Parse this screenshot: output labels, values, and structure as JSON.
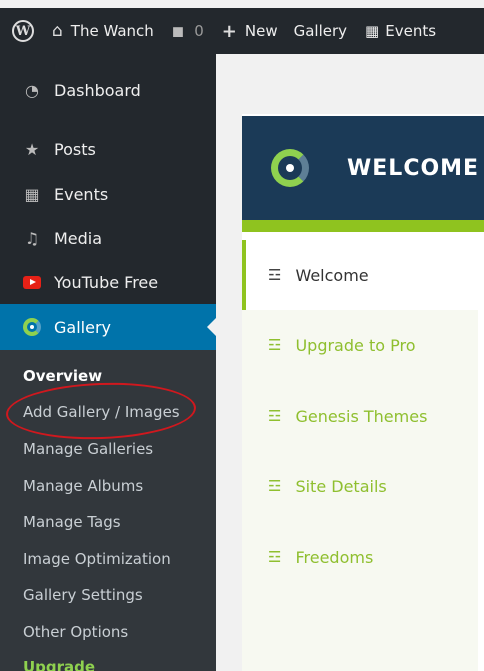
{
  "admin_bar": {
    "site_name": "The Wanch",
    "comments_count": "0",
    "new_label": "New",
    "gallery_label": "Gallery",
    "events_label": "Events"
  },
  "sidebar": {
    "items": [
      {
        "label": "Dashboard",
        "icon": "dashboard-icon"
      },
      {
        "label": "Posts",
        "icon": "pushpin-icon"
      },
      {
        "label": "Events",
        "icon": "calendar-icon"
      },
      {
        "label": "Media",
        "icon": "media-icon"
      },
      {
        "label": "YouTube Free",
        "icon": "youtube-icon"
      },
      {
        "label": "Gallery",
        "icon": "gallery-icon",
        "active": true
      }
    ],
    "submenu": [
      "Overview",
      "Add Gallery / Images",
      "Manage Galleries",
      "Manage Albums",
      "Manage Tags",
      "Image Optimization",
      "Gallery Settings",
      "Other Options",
      "Upgrade"
    ]
  },
  "main": {
    "header_title": "WELCOME",
    "tabs": [
      {
        "label": "Welcome",
        "active": true
      },
      {
        "label": "Upgrade to Pro"
      },
      {
        "label": "Genesis Themes"
      },
      {
        "label": "Site Details"
      },
      {
        "label": "Freedoms"
      }
    ]
  },
  "colors": {
    "admin_dark": "#23282d",
    "submenu_bg": "#32373c",
    "active_blue": "#0073aa",
    "accent_green": "#8fc31f",
    "header_navy": "#1b3a57",
    "annotation_red": "#d0181e"
  }
}
